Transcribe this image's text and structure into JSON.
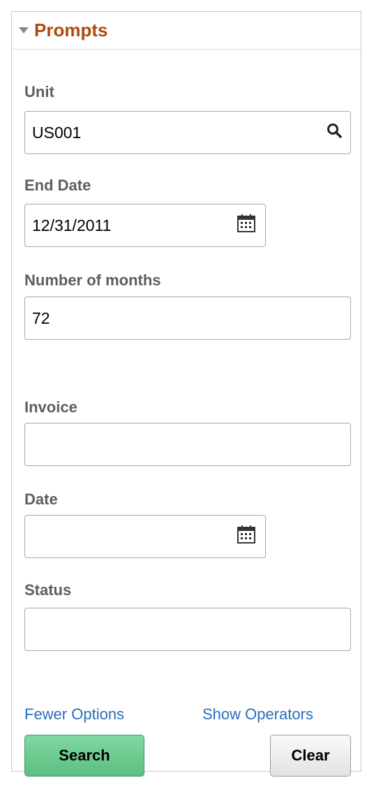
{
  "prompts": {
    "title": "Prompts",
    "unit": {
      "label": "Unit",
      "value": "US001"
    },
    "end_date": {
      "label": "End Date",
      "value": "12/31/2011"
    },
    "months": {
      "label": "Number of months",
      "value": "72"
    },
    "invoice": {
      "label": "Invoice",
      "value": ""
    },
    "date": {
      "label": "Date",
      "value": ""
    },
    "status": {
      "label": "Status",
      "value": ""
    },
    "fewer_options": "Fewer Options",
    "show_operators": "Show Operators",
    "search_button": "Search",
    "clear_button": "Clear"
  }
}
